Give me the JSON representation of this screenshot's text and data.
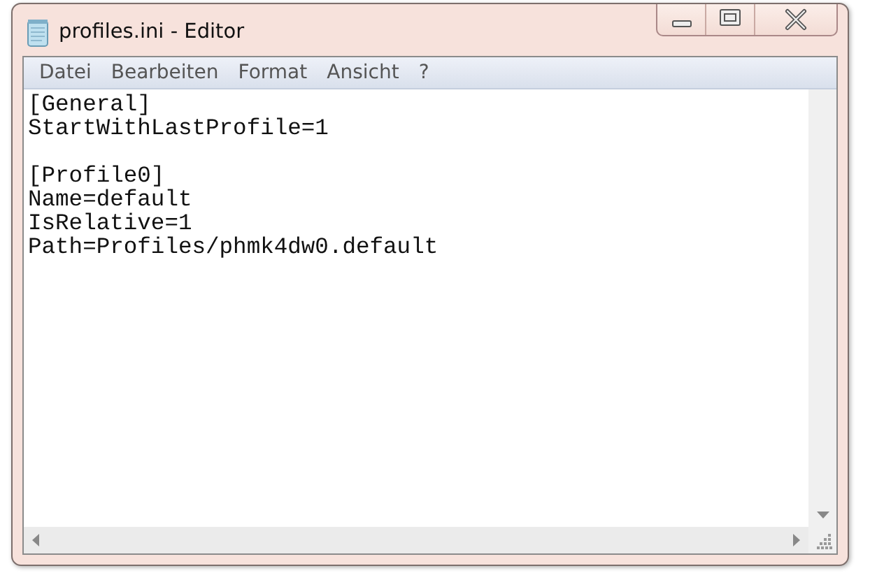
{
  "window": {
    "title": "profiles.ini - Editor"
  },
  "menu": [
    {
      "label": "Datei"
    },
    {
      "label": "Bearbeiten"
    },
    {
      "label": "Format"
    },
    {
      "label": "Ansicht"
    },
    {
      "label": "?"
    }
  ],
  "document": {
    "sections": [
      {
        "lines": [
          "[General]",
          "StartWithLastProfile=1"
        ]
      },
      {
        "lines": [
          "[Profile0]",
          "Name=default",
          "IsRelative=1",
          "Path=Profiles/phmk4dw0.default"
        ]
      }
    ]
  }
}
